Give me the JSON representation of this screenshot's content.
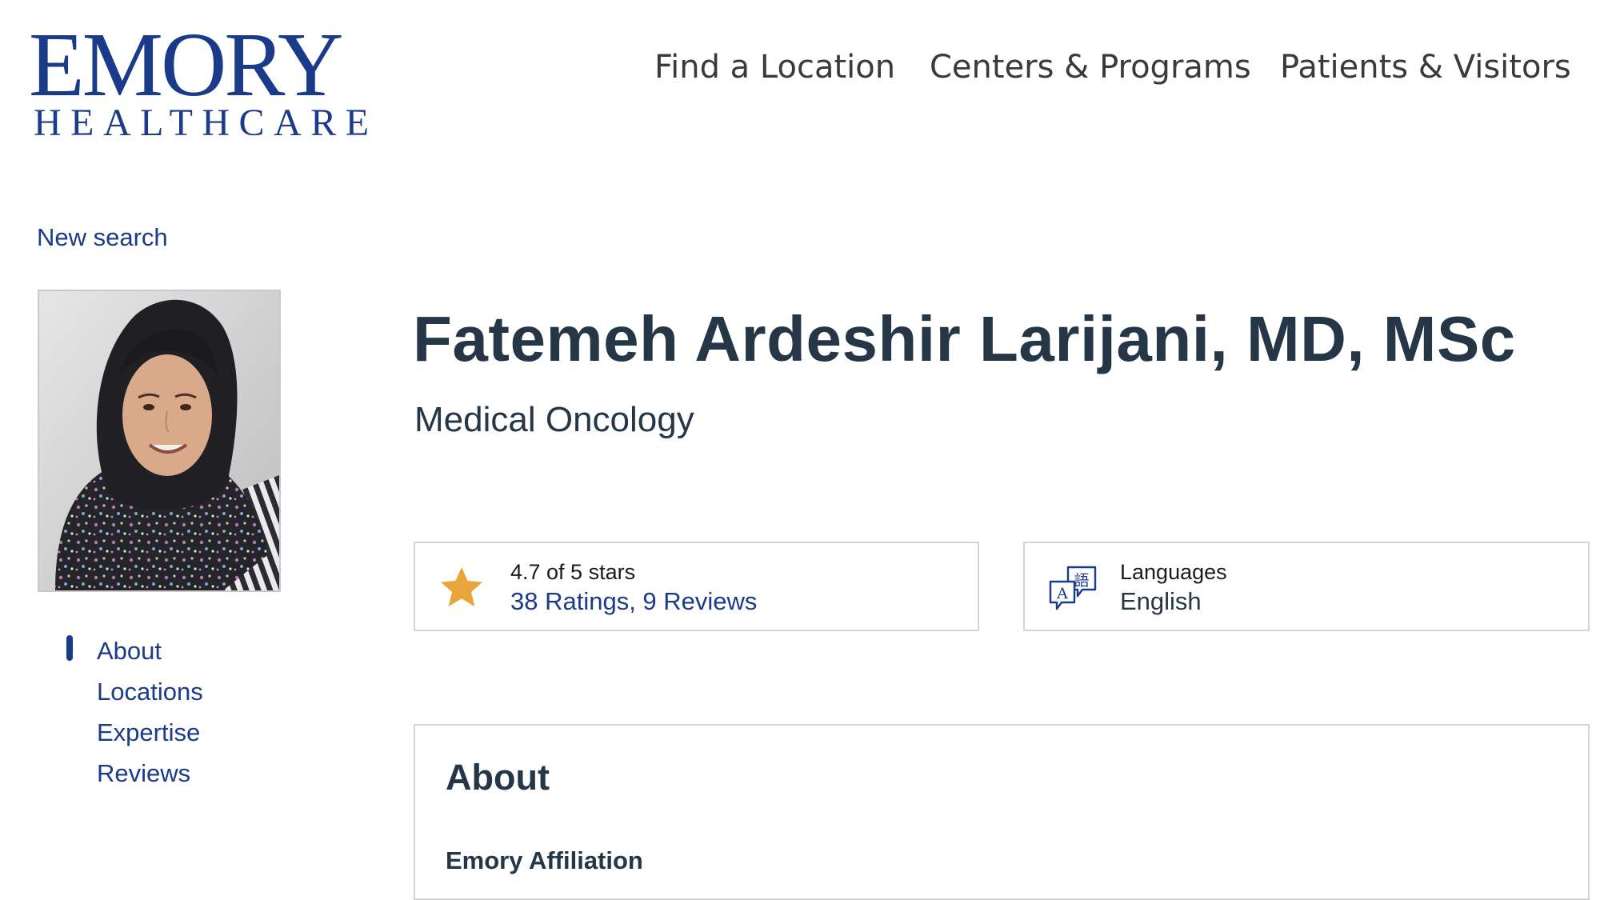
{
  "header": {
    "logo": {
      "word": "EMORY",
      "sub": "HEALTHCARE"
    },
    "nav": [
      {
        "label": "Find a Location"
      },
      {
        "label": "Centers & Programs"
      },
      {
        "label": "Patients & Visitors"
      }
    ]
  },
  "sidebar": {
    "new_search": "New search",
    "items": [
      {
        "label": "About",
        "active": true
      },
      {
        "label": "Locations"
      },
      {
        "label": "Expertise"
      },
      {
        "label": "Reviews"
      }
    ]
  },
  "profile": {
    "name": "Fatemeh Ardeshir Larijani, MD, MSc",
    "specialty": "Medical Oncology",
    "rating": {
      "title": "4.7 of 5 stars",
      "link": "38 Ratings, 9 Reviews",
      "value": 4.7,
      "max": 5
    },
    "languages": {
      "title": "Languages",
      "value": "English"
    }
  },
  "about": {
    "heading": "About",
    "subheading": "Emory Affiliation"
  },
  "icons": {
    "rating": "star-icon",
    "languages": "translate-icon"
  },
  "colors": {
    "brand": "#1a3a8a",
    "heading": "#253746",
    "star": "#e8a63a",
    "border": "#d4d4d4"
  }
}
